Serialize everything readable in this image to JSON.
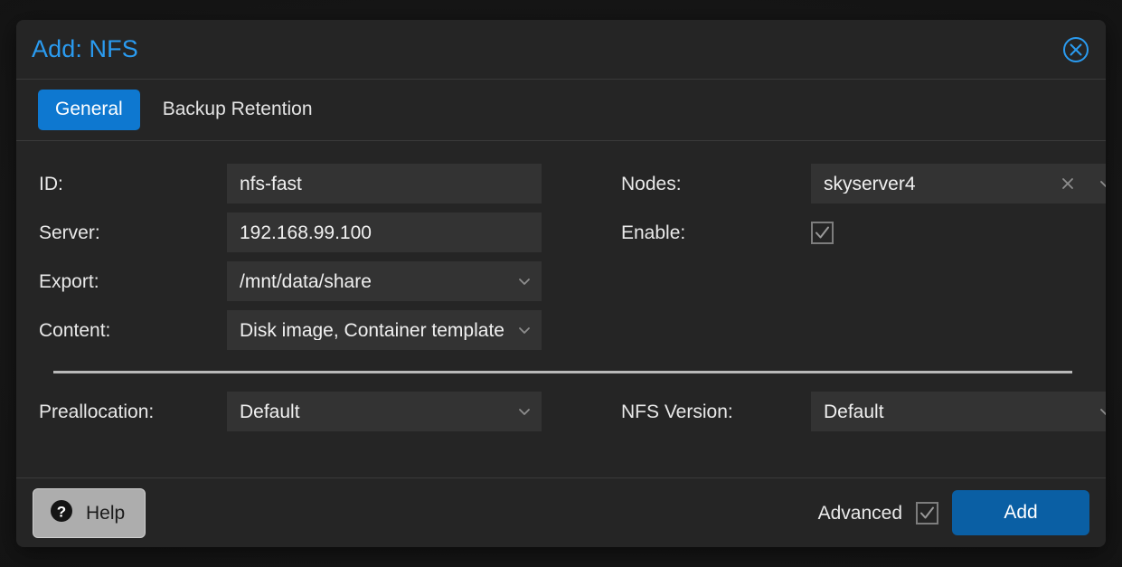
{
  "dialog": {
    "title": "Add: NFS",
    "close_icon": "close-circle-icon"
  },
  "tabs": [
    {
      "label": "General",
      "active": true
    },
    {
      "label": "Backup Retention",
      "active": false
    }
  ],
  "form": {
    "left": [
      {
        "label": "ID:",
        "value": "nfs-fast",
        "type": "text"
      },
      {
        "label": "Server:",
        "value": "192.168.99.100",
        "type": "text"
      },
      {
        "label": "Export:",
        "value": "/mnt/data/share",
        "type": "select"
      },
      {
        "label": "Content:",
        "value": "Disk image, Container template",
        "type": "select"
      }
    ],
    "right": [
      {
        "label": "Nodes:",
        "value": "skyserver4",
        "type": "multiselect",
        "clear_icon": "clear-x-icon"
      },
      {
        "label": "Enable:",
        "value": "",
        "type": "checkbox",
        "checked": true
      }
    ],
    "advanced": [
      {
        "label": "Preallocation:",
        "value": "Default",
        "type": "select"
      },
      {
        "label": "NFS Version:",
        "value": "Default",
        "type": "select"
      }
    ]
  },
  "footer": {
    "help_label": "Help",
    "help_icon": "question-circle-icon",
    "advanced_label": "Advanced",
    "advanced_checked": true,
    "add_label": "Add"
  },
  "colors": {
    "accent_blue": "#0e78d0",
    "title_blue": "#2a9bf0",
    "add_blue": "#0a5fa4",
    "dialog_bg": "#252525",
    "field_bg": "#333333"
  }
}
